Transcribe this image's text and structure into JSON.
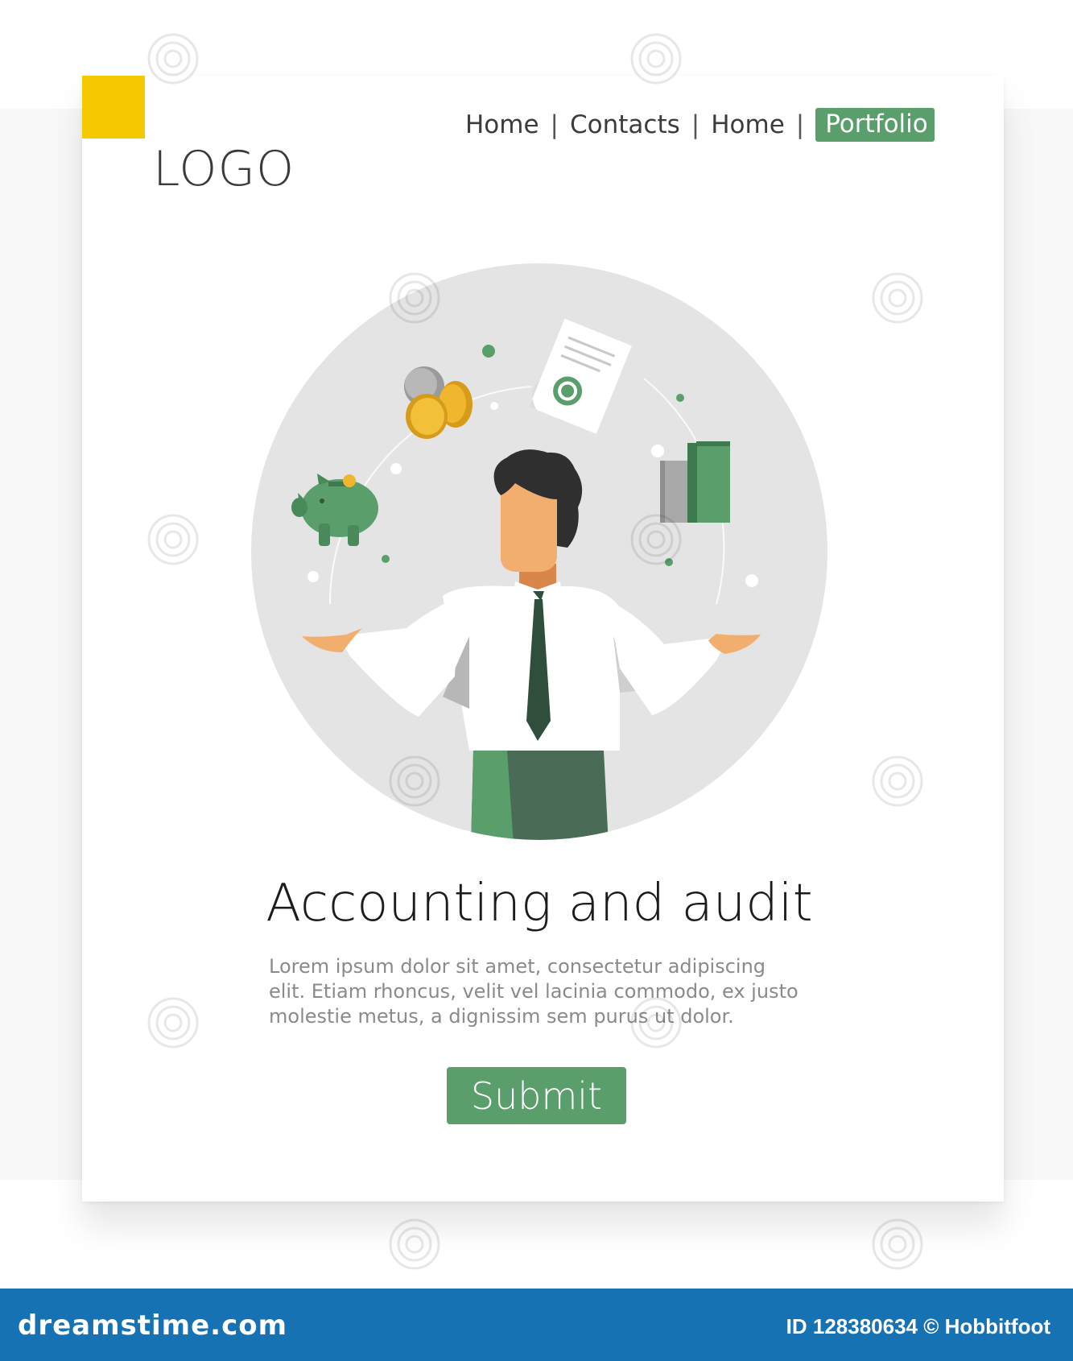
{
  "header": {
    "logo": "LOGO",
    "nav": [
      {
        "label": "Home",
        "active": false
      },
      {
        "label": "Contacts",
        "active": false
      },
      {
        "label": "Home",
        "active": false
      },
      {
        "label": "Portfolio",
        "active": true
      }
    ],
    "separator": "|"
  },
  "hero": {
    "title": "Accounting and audit",
    "body_lines": [
      "Lorem ipsum dolor sit amet, consectetur adipiscing",
      "elit. Etiam rhoncus, velit vel lacinia commodo, ex justo",
      "molestie metus, a dignissim sem purus ut dolor."
    ],
    "submit_label": "Submit"
  },
  "footer": {
    "brand": "dreamstime.com",
    "credit": "ID 128380634 © Hobbitfoot"
  },
  "illustration_icons": [
    "piggy-bank-icon",
    "coins-icon",
    "document-icon",
    "bar-chart-icon",
    "businessman-figure"
  ],
  "colors": {
    "accent_green": "#5a9e6c",
    "dark_green": "#4a6b55",
    "corner_yellow": "#f5c900",
    "circle_gray": "#e4e4e4",
    "footer_blue": "#1672b3"
  }
}
